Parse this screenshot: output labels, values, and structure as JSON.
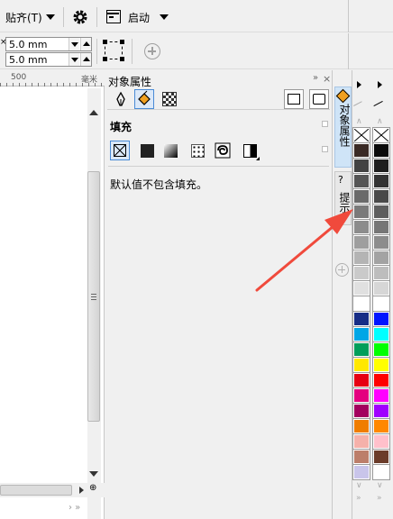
{
  "menubar": {
    "snap_label": "贴齐(T)",
    "launch_label": "启动"
  },
  "toolbar": {
    "width_value": "5.0 mm",
    "height_value": "5.0 mm"
  },
  "ruler": {
    "tick_label": "500",
    "unit_label": "毫米"
  },
  "panel": {
    "title": "对象属性",
    "section_fill": "填充",
    "no_fill_message": "默认值不包含填充。"
  },
  "side_tabs": {
    "object_properties_tab": "对象属性",
    "hints_tab": "提示",
    "hints_question": "?"
  },
  "colors": {
    "accent_blue": "#4a8bd6",
    "annotation_arrow": "#f04a3c",
    "palette_left": [
      "#3a2a25",
      "#424242",
      "#555555",
      "#6a6a6a",
      "#7a7a7a",
      "#8c8c8c",
      "#9e9e9e",
      "#b4b4b4",
      "#cacaca",
      "#e0e0e0",
      "#ffffff",
      "#172d86",
      "#00a6e6",
      "#009e5a",
      "#ffe800",
      "#e60012",
      "#e4007f",
      "#a3005e",
      "#ef7d00",
      "#f5b1aa",
      "#bc7e6a",
      "#c9c5ea"
    ],
    "palette_right": [
      "#0a0a0a",
      "#1e1e1e",
      "#333333",
      "#494949",
      "#5e5e5e",
      "#767676",
      "#8c8c8c",
      "#a3a3a3",
      "#bdbdbd",
      "#d6d6d6",
      "#ffffff",
      "#0016ff",
      "#00ffff",
      "#00ff00",
      "#ffff00",
      "#ff0000",
      "#ff00ff",
      "#a000ff",
      "#ff8800",
      "#ffc0cb",
      "#6b3c2a",
      "#ffffff"
    ]
  },
  "icons": [
    "gear-icon",
    "launch-icon",
    "node-icon",
    "add-icon",
    "pen-icon",
    "fill-bucket-icon",
    "transparency-icon",
    "no-fill-icon",
    "uniform-fill-icon",
    "fountain-fill-icon",
    "pattern-fill-icon",
    "texture-fill-icon",
    "postscript-fill-icon",
    "pin-icon",
    "close-icon",
    "eyedropper-icon",
    "zoom-icon"
  ]
}
